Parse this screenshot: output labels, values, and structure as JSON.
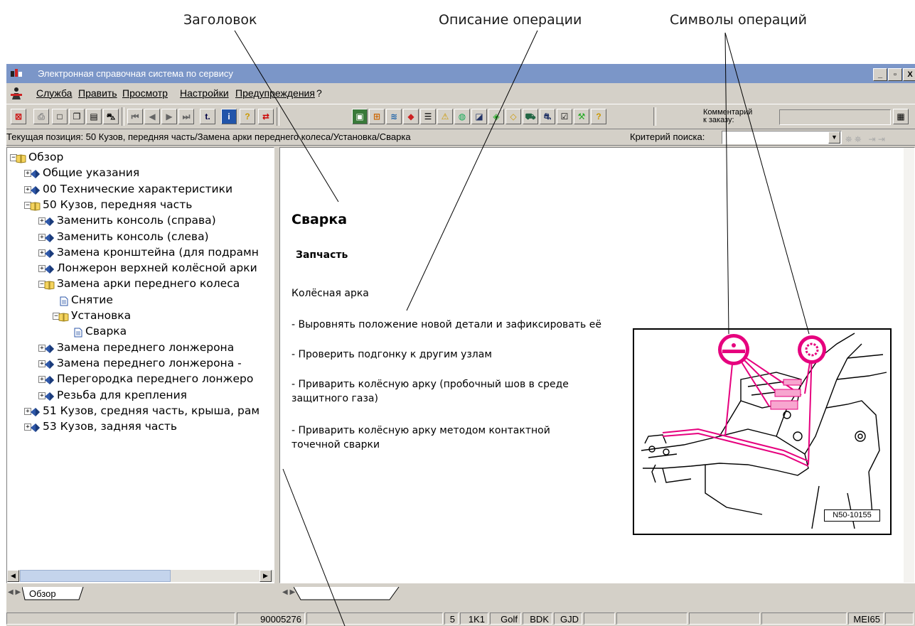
{
  "callouts": {
    "heading": "Заголовок",
    "description": "Описание операции",
    "symbols": "Символы операций"
  },
  "window": {
    "title": "Электронная справочная система по сервису",
    "controls": [
      "_",
      "̅❐",
      "X"
    ]
  },
  "menu": {
    "service": "Служба",
    "edit": "Править",
    "view": "Просмотр",
    "settings": "Настройки",
    "warnings": "Предупреждения",
    "help": "?"
  },
  "toolbar": {
    "comment_label_1": "Комментарий",
    "comment_label_2": "к заказу:",
    "icons": [
      "exit-icon",
      "print-icon",
      "new-doc-icon",
      "copy-doc-icon",
      "paste-doc-icon",
      "vehicle-icon",
      "first-icon",
      "prev-icon",
      "next-icon",
      "last-icon",
      "tree-icon",
      "info-icon",
      "help-icon",
      "swap-icon",
      "module-icon",
      "grid-icon",
      "stack-icon",
      "book-icon",
      "list-icon",
      "warning-icon",
      "globe-icon",
      "ruler-icon",
      "tool-icon",
      "checklist-icon",
      "car-icon",
      "car2-icon",
      "clipboard-icon",
      "wrench-icon",
      "question-doc-icon"
    ]
  },
  "position_bar": {
    "text": "Текущая позиция: 50 Кузов, передняя часть/Замена арки переднего колеса/Установка/Сварка",
    "search_label": "Критерий поиска:"
  },
  "tree": {
    "root": "Обзор",
    "items": [
      {
        "label": "Общие указания",
        "level": 1,
        "icon": "book"
      },
      {
        "label": "00 Технические характеристики",
        "level": 1,
        "icon": "book"
      },
      {
        "label": "50 Кузов, передняя часть",
        "level": 1,
        "icon": "open-book"
      },
      {
        "label": "Заменить консоль (справа)",
        "level": 2,
        "icon": "book"
      },
      {
        "label": "Заменить консоль (слева)",
        "level": 2,
        "icon": "book"
      },
      {
        "label": "Замена кронштейна (для подрамн",
        "level": 2,
        "icon": "book"
      },
      {
        "label": "Лонжерон верхней колёсной арки",
        "level": 2,
        "icon": "book"
      },
      {
        "label": "Замена арки переднего колеса",
        "level": 2,
        "icon": "open-book"
      },
      {
        "label": "Снятие",
        "level": 3,
        "icon": "page"
      },
      {
        "label": "Установка",
        "level": 3,
        "icon": "open-book"
      },
      {
        "label": "Сварка",
        "level": 4,
        "icon": "page"
      },
      {
        "label": "Замена переднего лонжерона",
        "level": 2,
        "icon": "book"
      },
      {
        "label": "Замена переднего лонжерона -",
        "level": 2,
        "icon": "book"
      },
      {
        "label": "Перегородка переднего лонжеро",
        "level": 2,
        "icon": "book"
      },
      {
        "label": "Резьба для крепления",
        "level": 2,
        "icon": "book"
      },
      {
        "label": "51 Кузов, средняя часть, крыша, рам",
        "level": 1,
        "icon": "book"
      },
      {
        "label": "53 Кузов, задняя часть",
        "level": 1,
        "icon": "book"
      }
    ],
    "tab": "Обзор"
  },
  "content": {
    "title": "Сварка",
    "subtitle": "Запчасть",
    "part": "Колёсная арка",
    "steps": [
      "- Выровнять положение новой детали и зафиксировать её",
      "- Проверить подгонку к другим узлам",
      "- Приварить колёсную арку (пробочный шов в среде",
      "защитного газа)",
      "- Приварить колёсную арку методом контактной",
      "точечной сварки"
    ],
    "figure_label": "N50-10155"
  },
  "status": {
    "cells": [
      "90005276",
      "5",
      "1K1",
      "Golf",
      "BDK",
      "GJD",
      "",
      "",
      "",
      "",
      "MEI65"
    ]
  },
  "colors": {
    "titlebar": "#7b96c8",
    "window": "#d4d0c8",
    "symbol": "#e6007e"
  }
}
